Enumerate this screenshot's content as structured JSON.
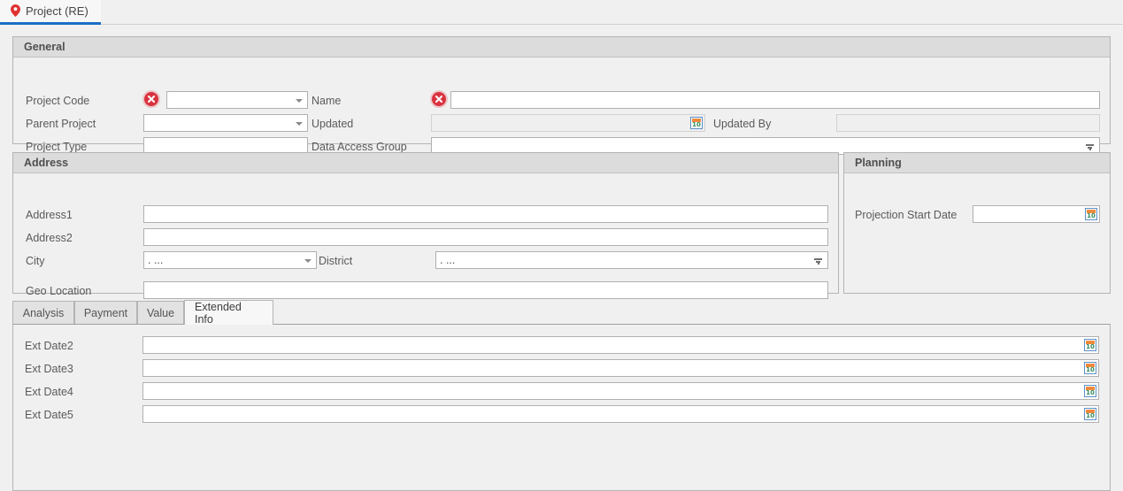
{
  "document_tab": {
    "label": "Project (RE)",
    "icon": "map-pin-icon",
    "accent_color": "#1a6fc4",
    "pin_color": "#e03131"
  },
  "general": {
    "title": "General",
    "fields": {
      "project_code": {
        "label": "Project Code",
        "value": "",
        "required": true,
        "control": "combo"
      },
      "parent_project": {
        "label": "Parent Project",
        "value": "",
        "required": false,
        "control": "combo"
      },
      "project_type": {
        "label": "Project Type",
        "value": "",
        "required": false,
        "control": "text"
      },
      "name": {
        "label": "Name",
        "value": "",
        "required": true,
        "control": "text"
      },
      "updated": {
        "label": "Updated",
        "value": "",
        "required": false,
        "control": "date",
        "disabled": true
      },
      "updated_by": {
        "label": "Updated By",
        "value": "",
        "required": false,
        "control": "text",
        "disabled": true
      },
      "data_access_group": {
        "label": "Data Access Group",
        "value": "",
        "required": false,
        "control": "lookup"
      }
    }
  },
  "address": {
    "title": "Address",
    "fields": {
      "address1": {
        "label": "Address1",
        "value": "",
        "control": "text"
      },
      "address2": {
        "label": "Address2",
        "value": "",
        "control": "text"
      },
      "city": {
        "label": "City",
        "value": ". ...",
        "control": "combo"
      },
      "district": {
        "label": "District",
        "value": ". ...",
        "control": "lookup"
      },
      "geo_location": {
        "label": "Geo Location",
        "value": "",
        "control": "text"
      }
    }
  },
  "planning": {
    "title": "Planning",
    "fields": {
      "projection_start_date": {
        "label": "Projection Start Date",
        "value": "",
        "control": "date"
      }
    }
  },
  "detail_tabs": {
    "items": [
      {
        "label": "Analysis",
        "active": false
      },
      {
        "label": "Payment",
        "active": false
      },
      {
        "label": "Value",
        "active": false
      },
      {
        "label": "Extended Info",
        "active": true
      }
    ],
    "extended_info": {
      "rows": [
        {
          "label": "Ext Date2",
          "value": ""
        },
        {
          "label": "Ext Date3",
          "value": ""
        },
        {
          "label": "Ext Date4",
          "value": ""
        },
        {
          "label": "Ext Date5",
          "value": ""
        }
      ]
    }
  },
  "icons": {
    "calendar_day": "10",
    "error_glyph": "✕"
  }
}
